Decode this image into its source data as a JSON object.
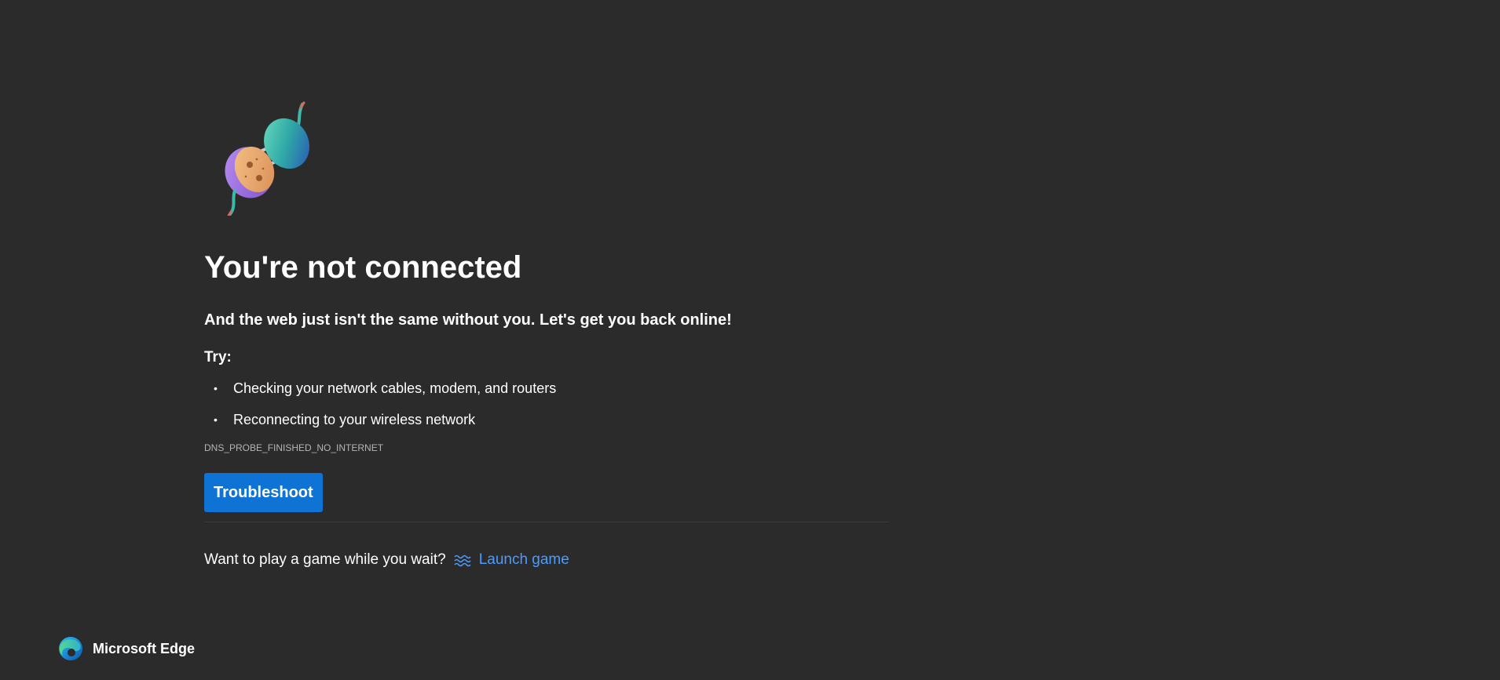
{
  "main": {
    "title": "You're not connected",
    "subtitle": "And the web just isn't the same without you. Let's get you back online!",
    "try_label": "Try:",
    "suggestions": [
      "Checking your network cables, modem, and routers",
      "Reconnecting to your wireless network"
    ],
    "error_code": "DNS_PROBE_FINISHED_NO_INTERNET",
    "troubleshoot_label": "Troubleshoot",
    "game_prompt": "Want to play a game while you wait?",
    "game_link_label": "Launch game",
    "game_icon": "surf-waves-icon",
    "illustration": "unplugged-plug-illustration"
  },
  "brand": {
    "name": "Microsoft Edge",
    "logo": "edge-logo-icon"
  },
  "colors": {
    "background": "#2b2b2b",
    "accent_button": "#0f73d5",
    "link": "#4c9bff",
    "muted_text": "#b5b5b5"
  }
}
